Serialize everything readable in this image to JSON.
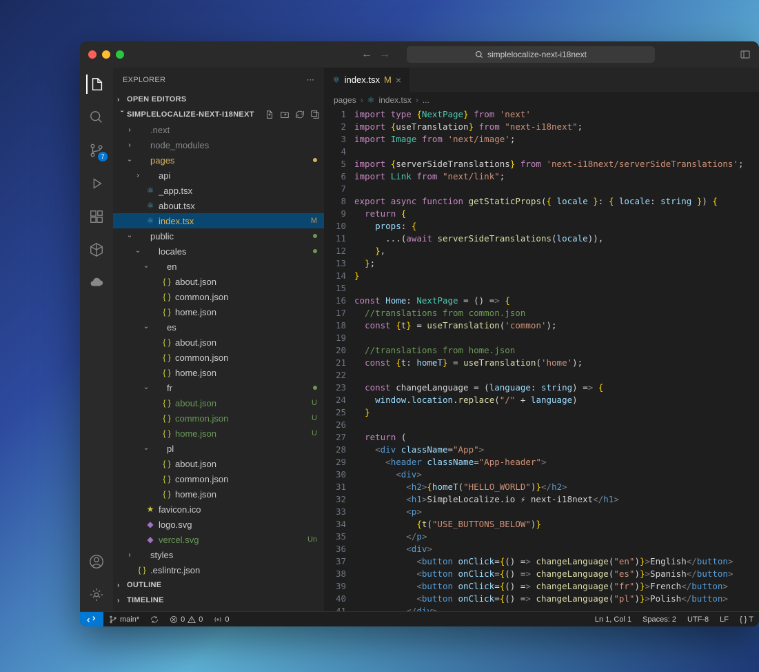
{
  "titlebar": {
    "search_placeholder": "simplelocalize-next-i18next"
  },
  "activitybar": {
    "scm_badge": "7"
  },
  "sidebar": {
    "title": "EXPLORER",
    "sections": {
      "open_editors": "OPEN EDITORS",
      "workspace": "SIMPLELOCALIZE-NEXT-I18NEXT",
      "outline": "OUTLINE",
      "timeline": "TIMELINE"
    },
    "tree": [
      {
        "type": "folder",
        "label": ".next",
        "indent": 1,
        "open": false,
        "dim": true
      },
      {
        "type": "folder",
        "label": "node_modules",
        "indent": 1,
        "open": false,
        "dim": true
      },
      {
        "type": "folder",
        "label": "pages",
        "indent": 1,
        "open": true,
        "color": "modified",
        "dotColor": "#d7b35f"
      },
      {
        "type": "folder",
        "label": "api",
        "indent": 2,
        "open": false
      },
      {
        "type": "file",
        "label": "_app.tsx",
        "indent": 2,
        "icon": "react"
      },
      {
        "type": "file",
        "label": "about.tsx",
        "indent": 2,
        "icon": "react"
      },
      {
        "type": "file",
        "label": "index.tsx",
        "indent": 2,
        "icon": "react",
        "selected": true,
        "badge": "M",
        "color": "modified"
      },
      {
        "type": "folder",
        "label": "public",
        "indent": 1,
        "open": true,
        "dotColor": "#6a9955"
      },
      {
        "type": "folder",
        "label": "locales",
        "indent": 2,
        "open": true,
        "dotColor": "#6a9955"
      },
      {
        "type": "folder",
        "label": "en",
        "indent": 3,
        "open": true
      },
      {
        "type": "file",
        "label": "about.json",
        "indent": 4,
        "icon": "json"
      },
      {
        "type": "file",
        "label": "common.json",
        "indent": 4,
        "icon": "json"
      },
      {
        "type": "file",
        "label": "home.json",
        "indent": 4,
        "icon": "json"
      },
      {
        "type": "folder",
        "label": "es",
        "indent": 3,
        "open": true
      },
      {
        "type": "file",
        "label": "about.json",
        "indent": 4,
        "icon": "json"
      },
      {
        "type": "file",
        "label": "common.json",
        "indent": 4,
        "icon": "json"
      },
      {
        "type": "file",
        "label": "home.json",
        "indent": 4,
        "icon": "json"
      },
      {
        "type": "folder",
        "label": "fr",
        "indent": 3,
        "open": true,
        "dotColor": "#6a9955"
      },
      {
        "type": "file",
        "label": "about.json",
        "indent": 4,
        "icon": "json",
        "badge": "U",
        "color": "untracked"
      },
      {
        "type": "file",
        "label": "common.json",
        "indent": 4,
        "icon": "json",
        "badge": "U",
        "color": "untracked"
      },
      {
        "type": "file",
        "label": "home.json",
        "indent": 4,
        "icon": "json",
        "badge": "U",
        "color": "untracked"
      },
      {
        "type": "folder",
        "label": "pl",
        "indent": 3,
        "open": true
      },
      {
        "type": "file",
        "label": "about.json",
        "indent": 4,
        "icon": "json"
      },
      {
        "type": "file",
        "label": "common.json",
        "indent": 4,
        "icon": "json"
      },
      {
        "type": "file",
        "label": "home.json",
        "indent": 4,
        "icon": "json"
      },
      {
        "type": "file",
        "label": "favicon.ico",
        "indent": 2,
        "icon": "star"
      },
      {
        "type": "file",
        "label": "logo.svg",
        "indent": 2,
        "icon": "svg"
      },
      {
        "type": "file",
        "label": "vercel.svg",
        "indent": 2,
        "icon": "svg",
        "badge": "Un",
        "color": "untracked"
      },
      {
        "type": "folder",
        "label": "styles",
        "indent": 1,
        "open": false
      },
      {
        "type": "file",
        "label": ".eslintrc.json",
        "indent": 1,
        "icon": "json"
      }
    ]
  },
  "editor": {
    "tab": {
      "label": "index.tsx",
      "badge": "M"
    },
    "breadcrumb": [
      "pages",
      "index.tsx",
      "..."
    ]
  },
  "statusbar": {
    "branch": "main*",
    "sync": "",
    "errors": "0",
    "warnings": "0",
    "port": "0",
    "cursor": "Ln 1, Col 1",
    "spaces": "Spaces: 2",
    "encoding": "UTF-8",
    "eol": "LF",
    "lang": "{ } T"
  },
  "code_lines": [
    "import type {NextPage} from 'next'",
    "import {useTranslation} from \"next-i18next\";",
    "import Image from 'next/image';",
    "",
    "import {serverSideTranslations} from 'next-i18next/serverSideTranslations';",
    "import Link from \"next/link\";",
    "",
    "export async function getStaticProps({ locale }: { locale: string }) {",
    "  return {",
    "    props: {",
    "      ...(await serverSideTranslations(locale)),",
    "    },",
    "  };",
    "}",
    "",
    "const Home: NextPage = () => {",
    "  //translations from common.json",
    "  const {t} = useTranslation('common');",
    "",
    "  //translations from home.json",
    "  const {t: homeT} = useTranslation('home');",
    "",
    "  const changeLanguage = (language: string) => {",
    "    window.location.replace(\"/\" + language)",
    "  }",
    "",
    "  return (",
    "    <div className=\"App\">",
    "      <header className=\"App-header\">",
    "        <div>",
    "          <h2>{homeT(\"HELLO_WORLD\")}</h2>",
    "          <h1>SimpleLocalize.io ⚡ next-i18next</h1>",
    "          <p>",
    "            {t(\"USE_BUTTONS_BELOW\")}",
    "          </p>",
    "          <div>",
    "            <button onClick={() => changeLanguage(\"en\")}>English</button>",
    "            <button onClick={() => changeLanguage(\"es\")}>Spanish</button>",
    "            <button onClick={() => changeLanguage(\"fr\")}>French</button>",
    "            <button onClick={() => changeLanguage(\"pl\")}>Polish</button>",
    "          </div>"
  ]
}
